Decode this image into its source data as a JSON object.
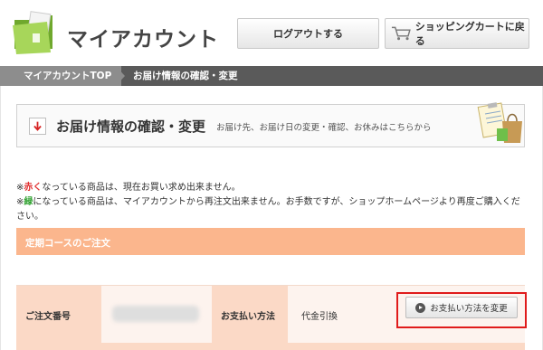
{
  "header": {
    "title": "マイアカウント",
    "logout_label": "ログアウトする",
    "cart_label": "ショッピングカートに戻る",
    "colors": {
      "folder_green": "#8dc63f",
      "folder_front": "#a7d65a"
    }
  },
  "breadcrumb": {
    "items": [
      "マイアカウントTOP",
      "お届け情報の確認・変更"
    ]
  },
  "section": {
    "title": "お届け情報の確認・変更",
    "description": "お届け先、お届け日の変更・確認、お休みはこちらから",
    "icons": [
      "down-arrow-icon",
      "clipboard-bag-icon"
    ]
  },
  "notes": {
    "line1_prefix": "※",
    "line1_red": "赤く",
    "line1_suffix": "なっている商品は、現在お買い求め出来ません。",
    "line2_prefix": "※",
    "line2_green": "緑",
    "line2_suffix": "になっている商品は、マイアカウントから再注文出来ません。お手数ですが、ショップホームページより再度ご購入ください。"
  },
  "course": {
    "title": "定期コースのご注文",
    "color": "#fbb68d"
  },
  "order": {
    "order_number_label": "ご注文番号",
    "payment_label": "お支払い方法",
    "payment_value": "代金引換",
    "change_button_label": "お支払い方法を変更",
    "highlight_color": "#e01b1b"
  }
}
